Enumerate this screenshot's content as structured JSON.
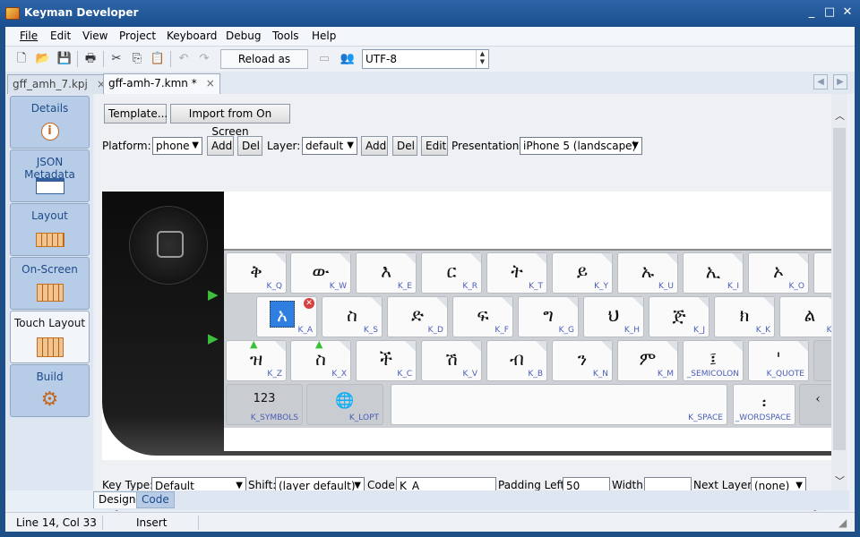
{
  "window": {
    "title": "Keyman Developer",
    "controls": [
      "_",
      "□",
      "✕"
    ]
  },
  "menu": [
    "File",
    "Edit",
    "View",
    "Project",
    "Keyboard",
    "Debug",
    "Tools",
    "Help"
  ],
  "toolbar": {
    "icons": [
      "new-file-icon",
      "open-folder-icon",
      "save-icon",
      "print-icon",
      "cut-icon",
      "copy-icon",
      "paste-icon",
      "undo-icon",
      "redo-icon",
      "window-icon",
      "people-icon"
    ],
    "reload_label": "Reload as format",
    "encoding": "UTF-8"
  },
  "tabs": [
    {
      "label": "gff_amh_7.kpj",
      "close": "×"
    },
    {
      "label": "gff-amh-7.kmn *",
      "close": "×"
    }
  ],
  "sidebar": {
    "items": [
      {
        "label": "Details",
        "icon": "info-icon"
      },
      {
        "label": "JSON Metadata",
        "icon": "json-icon"
      },
      {
        "label": "Layout",
        "icon": "keyboard-icon"
      },
      {
        "label": "On-Screen",
        "icon": "onscreen-keyboard-icon"
      },
      {
        "label": "Touch Layout",
        "icon": "touch-keyboard-icon"
      },
      {
        "label": "Build",
        "icon": "gear-icon"
      }
    ],
    "active": "Touch Layout"
  },
  "editor": {
    "template_label": "Template...",
    "import_label": "Import from On Screen",
    "platform_label": "Platform:",
    "platform_value": "phone",
    "add_label": "Add",
    "del_label": "Del",
    "layer_label": "Layer:",
    "layer_value": "default",
    "edit_label": "Edit",
    "presentation_label": "Presentation:",
    "presentation_value": "iPhone 5 (landscape)"
  },
  "keyboard": {
    "rows": [
      [
        [
          "ቅ",
          "K_Q"
        ],
        [
          "ው",
          "K_W"
        ],
        [
          "እ",
          "K_E"
        ],
        [
          "ር",
          "K_R"
        ],
        [
          "ት",
          "K_T"
        ],
        [
          "ይ",
          "K_Y"
        ],
        [
          "ኡ",
          "K_U"
        ],
        [
          "ኢ",
          "K_I"
        ],
        [
          "ኦ",
          "K_O"
        ],
        [
          "",
          ""
        ]
      ],
      [
        [
          "አ",
          "K_A"
        ],
        [
          "ስ",
          "K_S"
        ],
        [
          "ድ",
          "K_D"
        ],
        [
          "ፍ",
          "K_F"
        ],
        [
          "ግ",
          "K_G"
        ],
        [
          "ህ",
          "K_H"
        ],
        [
          "ጅ",
          "K_J"
        ],
        [
          "ክ",
          "K_K"
        ],
        [
          "ል",
          "K_"
        ]
      ],
      [
        [
          "ዝ",
          "K_Z"
        ],
        [
          "ስ",
          "K_X"
        ],
        [
          "ች",
          "K_C"
        ],
        [
          "ሽ",
          "K_V"
        ],
        [
          "ብ",
          "K_B"
        ],
        [
          "ን",
          "K_N"
        ],
        [
          "ም",
          "K_M"
        ],
        [
          "፤",
          "_SEMICOLON"
        ],
        [
          "'",
          "K_QUOTE"
        ],
        [
          "",
          ""
        ]
      ],
      [
        [
          "123",
          "K_SYMBOLS"
        ],
        [
          "🌐",
          "K_LOPT"
        ],
        [
          "",
          "K_SPACE"
        ],
        [
          "፡",
          "_WORDSPACE"
        ],
        [
          "‹",
          ""
        ]
      ]
    ],
    "selected_key": "K_A"
  },
  "properties": {
    "key_type_label": "Key Type:",
    "key_type_value": "Default",
    "shift_label": "Shift:",
    "shift_value": "(layer default)",
    "code_label": "Code:",
    "code_value": "K_A",
    "padding_label": "Padding Left:",
    "padding_value": "50",
    "width_label": "Width:",
    "width_value": "",
    "next_layer_label": "Next Layer:",
    "next_layer_value": "(none)"
  },
  "bottom_tabs": [
    "Design",
    "Code"
  ],
  "status": {
    "position": "Line 14, Col 33",
    "mode": "Insert"
  }
}
